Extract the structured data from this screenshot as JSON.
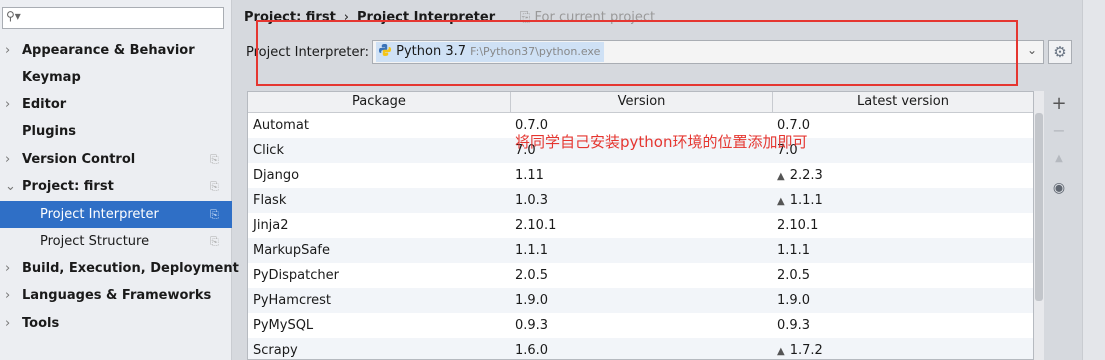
{
  "search": {
    "icon": "search-icon"
  },
  "sidebar": {
    "items": [
      {
        "label": "Appearance & Behavior",
        "arrow": "›"
      },
      {
        "label": "Keymap",
        "arrow": ""
      },
      {
        "label": "Editor",
        "arrow": "›"
      },
      {
        "label": "Plugins",
        "arrow": ""
      },
      {
        "label": "Version Control",
        "arrow": "›"
      },
      {
        "label": "Project: first",
        "arrow": "⌄"
      },
      {
        "label": "Project Interpreter",
        "arrow": ""
      },
      {
        "label": "Project Structure",
        "arrow": ""
      },
      {
        "label": "Build, Execution, Deployment",
        "arrow": "›"
      },
      {
        "label": "Languages & Frameworks",
        "arrow": "›"
      },
      {
        "label": "Tools",
        "arrow": "›"
      }
    ]
  },
  "header": {
    "crumb_project": "Project: first",
    "crumb_separator": "›",
    "crumb_page": "Project Interpreter",
    "scope": "For current project"
  },
  "interpreter": {
    "label": "Project Interpreter:",
    "name": "Python 3.7",
    "path": "F:\\Python37\\python.exe"
  },
  "table": {
    "headers": [
      "Package",
      "Version",
      "Latest version"
    ],
    "rows": [
      {
        "package": "Automat",
        "version": "0.7.0",
        "latest": "0.7.0",
        "upgrade": false
      },
      {
        "package": "Click",
        "version": "7.0",
        "latest": "7.0",
        "upgrade": false
      },
      {
        "package": "Django",
        "version": "1.11",
        "latest": "2.2.3",
        "upgrade": true
      },
      {
        "package": "Flask",
        "version": "1.0.3",
        "latest": "1.1.1",
        "upgrade": true
      },
      {
        "package": "Jinja2",
        "version": "2.10.1",
        "latest": "2.10.1",
        "upgrade": false
      },
      {
        "package": "MarkupSafe",
        "version": "1.1.1",
        "latest": "1.1.1",
        "upgrade": false
      },
      {
        "package": "PyDispatcher",
        "version": "2.0.5",
        "latest": "2.0.5",
        "upgrade": false
      },
      {
        "package": "PyHamcrest",
        "version": "1.9.0",
        "latest": "1.9.0",
        "upgrade": false
      },
      {
        "package": "PyMySQL",
        "version": "0.9.3",
        "latest": "0.9.3",
        "upgrade": false
      },
      {
        "package": "Scrapy",
        "version": "1.6.0",
        "latest": "1.7.2",
        "upgrade": true
      }
    ]
  },
  "annotation": {
    "text": "将同学自己安装python环境的位置添加即可",
    "color": "#e53630"
  },
  "tools": {
    "add": "+",
    "remove": "−",
    "upgrade": "▲",
    "show_early": "◉"
  },
  "colors": {
    "selection": "#2f6fc6",
    "highlight_box": "#e53630"
  }
}
